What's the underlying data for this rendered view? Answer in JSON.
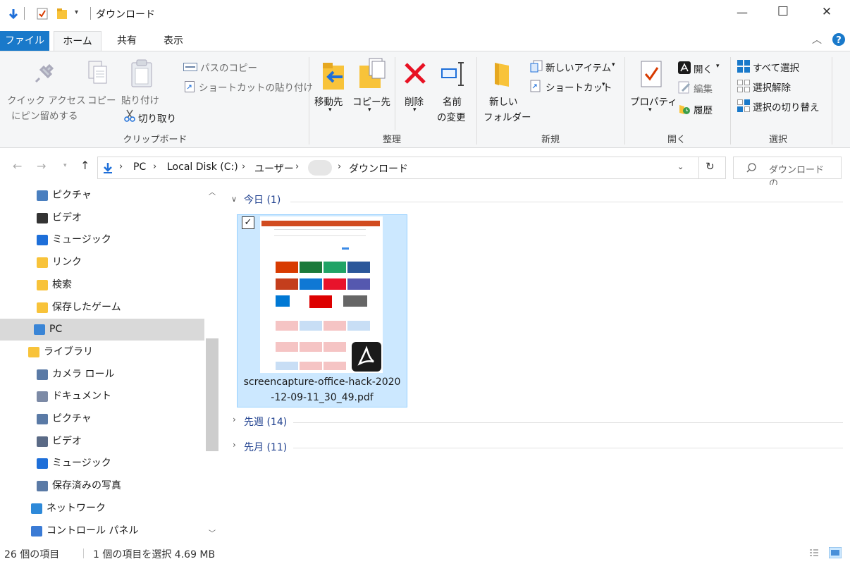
{
  "window": {
    "title": "ダウンロード",
    "controls": {
      "minimize": "—",
      "maximize": "☐",
      "close": "✕"
    }
  },
  "ribbon_tabs": {
    "file": "ファイル",
    "home": "ホーム",
    "share": "共有",
    "view": "表示"
  },
  "ribbon": {
    "clipboard": {
      "pin_line1": "クイック アクセス",
      "pin_line2": "にピン留めする",
      "copy": "コピー",
      "paste": "貼り付け",
      "copy_path": "パスのコピー",
      "paste_shortcut": "ショートカットの貼り付け",
      "cut": "切り取り",
      "label": "クリップボード"
    },
    "organize": {
      "move_to": "移動先",
      "copy_to": "コピー先",
      "delete": "削除",
      "rename_line1": "名前",
      "rename_line2": "の変更",
      "label": "整理"
    },
    "new": {
      "new_folder_line1": "新しい",
      "new_folder_line2": "フォルダー",
      "new_item": "新しいアイテム",
      "shortcut": "ショートカット",
      "label": "新規"
    },
    "open": {
      "properties": "プロパティ",
      "open": "開く",
      "edit": "編集",
      "history": "履歴",
      "label": "開く"
    },
    "select": {
      "select_all": "すべて選択",
      "select_none": "選択解除",
      "invert": "選択の切り替え",
      "label": "選択"
    }
  },
  "address": {
    "crumbs": [
      "PC",
      "Local Disk (C:)",
      "ユーザー",
      "",
      "ダウンロード"
    ],
    "search_placeholder": "ダウンロードの..."
  },
  "nav_items": [
    {
      "label": "ピクチャ",
      "icon": "pictures-icon"
    },
    {
      "label": "ビデオ",
      "icon": "video-icon"
    },
    {
      "label": "ミュージック",
      "icon": "music-icon"
    },
    {
      "label": "リンク",
      "icon": "link-folder-icon"
    },
    {
      "label": "検索",
      "icon": "search-folder-icon"
    },
    {
      "label": "保存したゲーム",
      "icon": "saved-games-icon"
    },
    {
      "label": "PC",
      "icon": "pc-icon"
    },
    {
      "label": "ライブラリ",
      "icon": "library-icon"
    },
    {
      "label": "カメラ ロール",
      "icon": "camera-roll-icon"
    },
    {
      "label": "ドキュメント",
      "icon": "documents-icon"
    },
    {
      "label": "ピクチャ",
      "icon": "pictures-library-icon"
    },
    {
      "label": "ビデオ",
      "icon": "video-library-icon"
    },
    {
      "label": "ミュージック",
      "icon": "music-library-icon"
    },
    {
      "label": "保存済みの写真",
      "icon": "saved-pictures-icon"
    },
    {
      "label": "ネットワーク",
      "icon": "network-icon"
    },
    {
      "label": "コントロール パネル",
      "icon": "control-panel-icon"
    }
  ],
  "groups": [
    {
      "label": "今日 (1)",
      "expanded": true
    },
    {
      "label": "先週 (14)",
      "expanded": false
    },
    {
      "label": "先月 (11)",
      "expanded": false
    }
  ],
  "file": {
    "name_line1": "screencapture-office-hack-2020",
    "name_line2": "-12-09-11_30_49.pdf",
    "selected": true
  },
  "status": {
    "count": "26 個の項目",
    "selection": "1 個の項目を選択  4.69 MB"
  },
  "colors": {
    "accent": "#0063b1",
    "selection": "#cce8ff",
    "selection_border": "#99d1ff",
    "nav_selected": "#d9d9d9",
    "group_header": "#1e3f8e"
  }
}
